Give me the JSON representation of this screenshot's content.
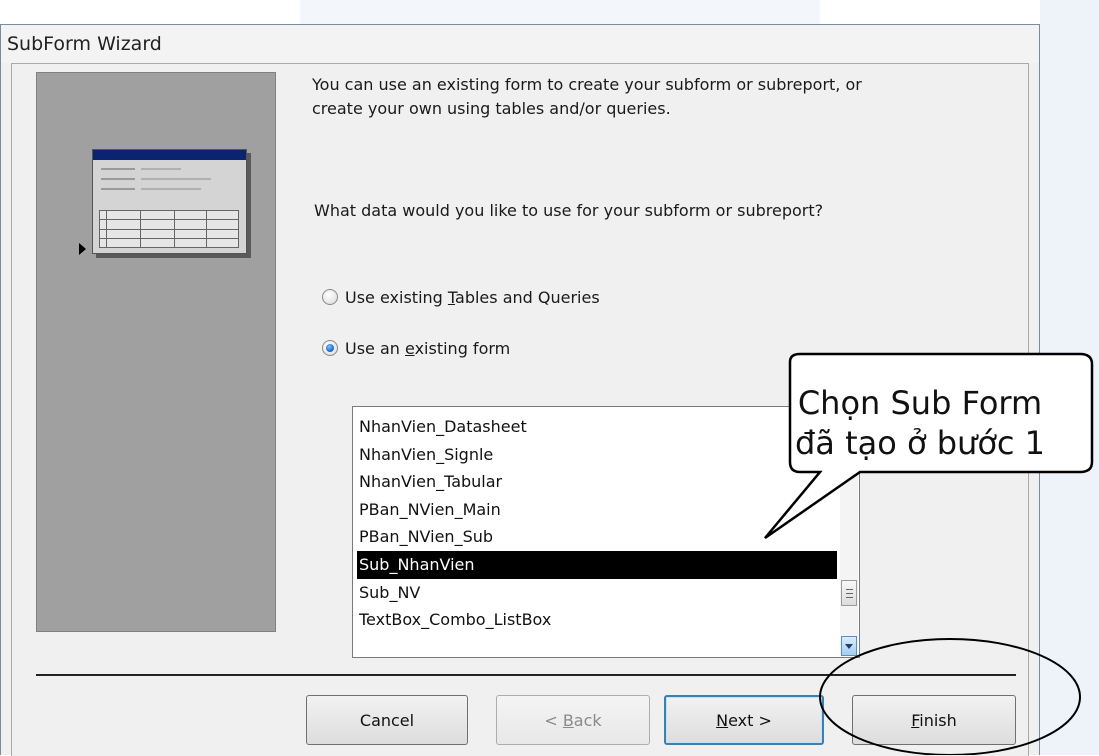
{
  "window": {
    "title": "SubForm Wizard"
  },
  "intro_text": [
    "You can use an existing form to create your subform or subreport, or",
    "create your own using tables and/or queries."
  ],
  "question": "What data would you like to use for your subform or subreport?",
  "options": [
    {
      "label_pre": "Use existing ",
      "accel": "T",
      "label_post": "ables and Queries",
      "selected": false
    },
    {
      "label_pre": "Use an ",
      "accel": "e",
      "label_post": "xisting form",
      "selected": true
    }
  ],
  "forms_list": {
    "items": [
      "NhanVien_Datasheet",
      "NhanVien_Signle",
      "NhanVien_Tabular",
      "PBan_NVien_Main",
      "PBan_NVien_Sub",
      "Sub_NhanVien",
      "Sub_NV",
      "TextBox_Combo_ListBox"
    ],
    "selected": "Sub_NhanVien"
  },
  "buttons": {
    "cancel": "Cancel",
    "back_pre": "< ",
    "back_accel": "B",
    "back_post": "ack",
    "next_accel": "N",
    "next_post": "ext >",
    "finish_accel": "F",
    "finish_post": "inish"
  },
  "annotation": {
    "line1": "Chọn Sub Form",
    "line2": "đã tạo ở bước 1"
  },
  "icons": {
    "wizard_picture": "form-with-subform-icon",
    "pointer": "triangle-pointer-icon"
  }
}
